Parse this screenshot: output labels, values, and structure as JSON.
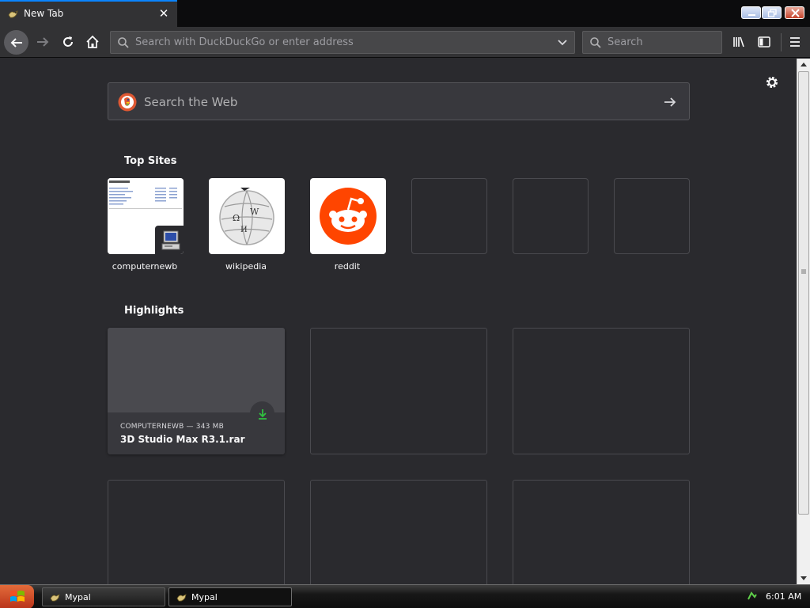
{
  "browser": {
    "tab": {
      "title": "New Tab"
    },
    "urlbar": {
      "placeholder": "Search with DuckDuckGo or enter address"
    },
    "searchbar": {
      "placeholder": "Search"
    }
  },
  "newtab": {
    "websearch": {
      "placeholder": "Search the Web"
    },
    "top_sites_title": "Top Sites",
    "top_sites": [
      {
        "label": "computernewb"
      },
      {
        "label": "wikipedia"
      },
      {
        "label": "reddit"
      },
      {
        "label": ""
      },
      {
        "label": ""
      },
      {
        "label": ""
      }
    ],
    "highlights_title": "Highlights",
    "highlights": [
      {
        "source": "COMPUTERNEWB — 343 MB",
        "title": "3D Studio Max R3.1.rar"
      }
    ]
  },
  "taskbar": {
    "tasks": [
      {
        "label": "Mypal",
        "active": false
      },
      {
        "label": "Mypal",
        "active": true
      }
    ],
    "clock": "6:01 AM"
  },
  "colors": {
    "accent": "#0a84ff",
    "reddit": "#ff4500",
    "download_green": "#30c040"
  }
}
